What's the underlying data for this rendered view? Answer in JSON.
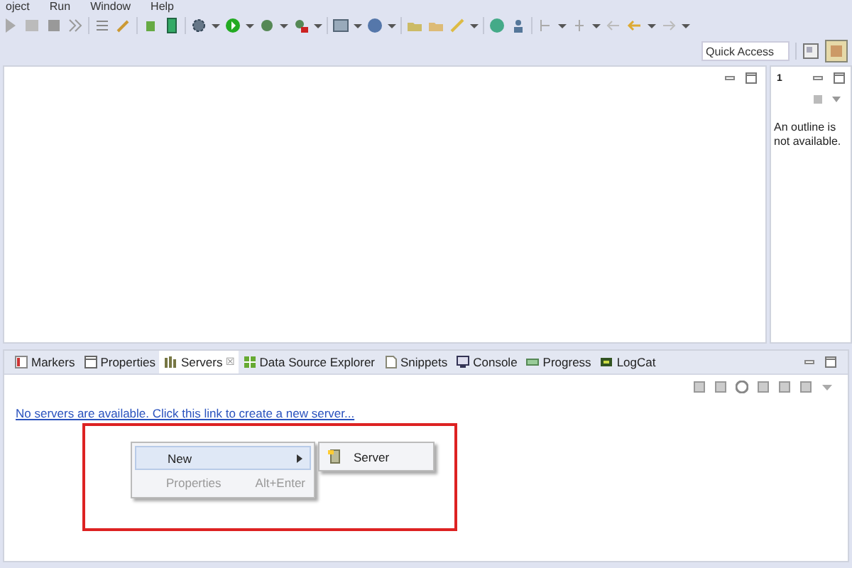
{
  "menu_bar": [
    "oject",
    "Run",
    "Window",
    "Help"
  ],
  "quick_access": {
    "placeholder": "Quick Access"
  },
  "outline": {
    "tab_label": "1",
    "message": "An outline is not available."
  },
  "bottom_panel": {
    "tabs": [
      {
        "label": "Markers",
        "selected": false
      },
      {
        "label": "Properties",
        "selected": false
      },
      {
        "label": "Servers",
        "selected": true,
        "close": "☒"
      },
      {
        "label": "Data Source Explorer",
        "selected": false
      },
      {
        "label": "Snippets",
        "selected": false
      },
      {
        "label": "Console",
        "selected": false
      },
      {
        "label": "Progress",
        "selected": false
      },
      {
        "label": "LogCat",
        "selected": false
      }
    ],
    "link": "No servers are available. Click this link to create a new server..."
  },
  "context_menu": {
    "items": [
      {
        "label": "New",
        "submenu": true,
        "selected": true,
        "disabled": false
      },
      {
        "label": "Properties",
        "shortcut": "Alt+Enter",
        "submenu": false,
        "selected": false,
        "disabled": true
      }
    ],
    "submenu": [
      {
        "label": "Server",
        "selected": false
      }
    ]
  }
}
